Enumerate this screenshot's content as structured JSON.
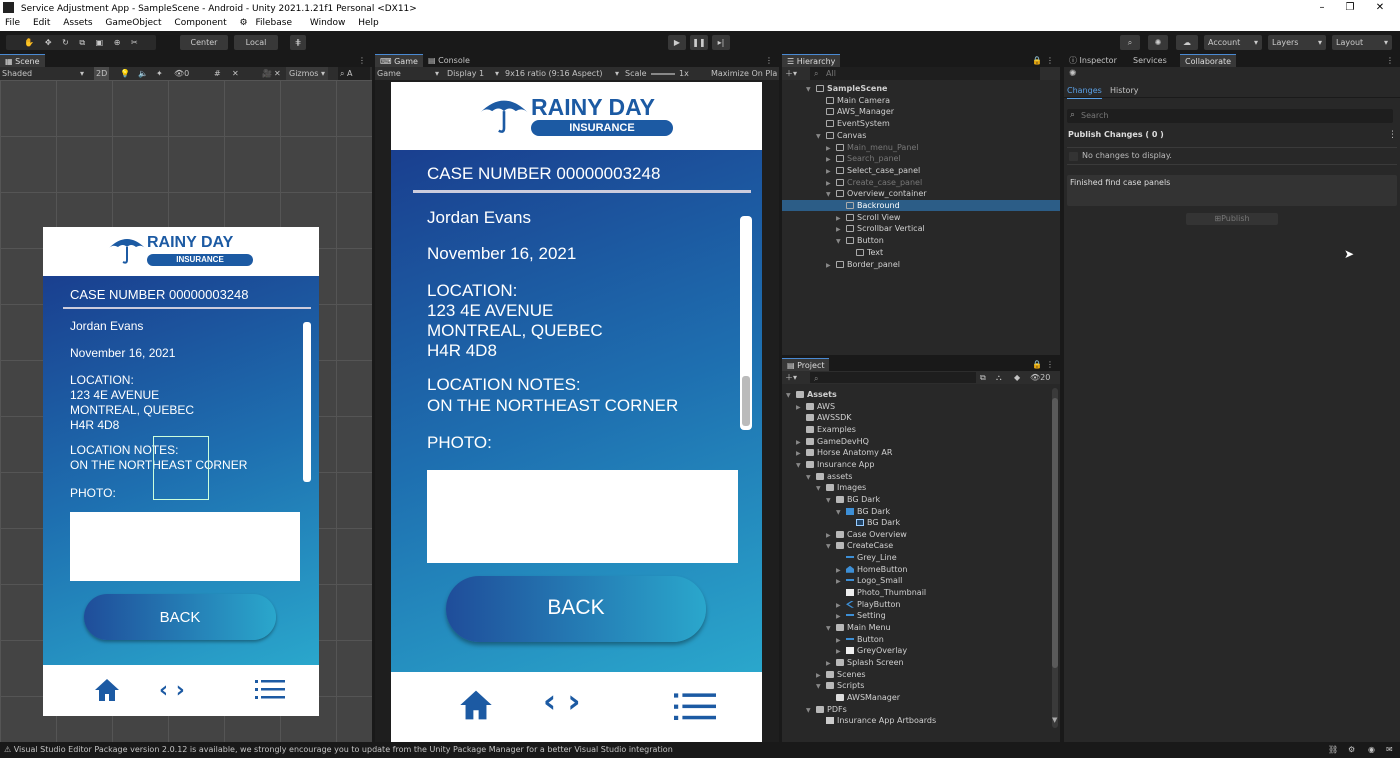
{
  "window": {
    "title": "Service Adjustment App - SampleScene - Android - Unity 2021.1.21f1 Personal <DX11>",
    "minimize": "–",
    "maximize": "❐",
    "close": "✕"
  },
  "menu": [
    "File",
    "Edit",
    "Assets",
    "GameObject",
    "Component",
    "Filebase",
    "Window",
    "Help"
  ],
  "toolbar": {
    "pivot": "Center",
    "space": "Local",
    "account": "Account",
    "layers": "Layers",
    "layout": "Layout"
  },
  "scene_panel": {
    "tab": "Scene",
    "shading": "Shaded",
    "mode": "2D",
    "gizmos": "Gizmos"
  },
  "game_panel": {
    "tabs": [
      "Game",
      "Console"
    ],
    "display_mode": "Game",
    "display": "Display 1",
    "aspect": "9x16 ratio (9:16 Aspect)",
    "scale_label": "Scale",
    "scale_value": "1x",
    "maximize": "Maximize On Pla"
  },
  "app": {
    "brand": "RAINY DAY",
    "brand_sub": "INSURANCE",
    "case_number": "CASE NUMBER 00000003248",
    "name": "Jordan Evans",
    "date": "November 16, 2021",
    "location_label": "LOCATION:",
    "location_lines": [
      "123 4E AVENUE",
      "MONTREAL, QUEBEC",
      "H4R 4D8"
    ],
    "notes_label": "LOCATION NOTES:",
    "notes": "ON THE NORTHEAST CORNER",
    "photo_label": "PHOTO:",
    "back": "BACK"
  },
  "hierarchy": {
    "tab": "Hierarchy",
    "search_placeholder": "All",
    "rows": [
      {
        "label": "SampleScene",
        "depth": 0,
        "state": "normal",
        "arrow": "▼"
      },
      {
        "label": "Main Camera",
        "depth": 1,
        "state": "normal",
        "arrow": ""
      },
      {
        "label": "AWS_Manager",
        "depth": 1,
        "state": "normal",
        "arrow": ""
      },
      {
        "label": "EventSystem",
        "depth": 1,
        "state": "normal",
        "arrow": ""
      },
      {
        "label": "Canvas",
        "depth": 1,
        "state": "normal",
        "arrow": "▼"
      },
      {
        "label": "Main_menu_Panel",
        "depth": 2,
        "state": "dim",
        "arrow": "▶"
      },
      {
        "label": "Search_panel",
        "depth": 2,
        "state": "dim",
        "arrow": "▶"
      },
      {
        "label": "Select_case_panel",
        "depth": 2,
        "state": "normal",
        "arrow": "▶"
      },
      {
        "label": "Create_case_panel",
        "depth": 2,
        "state": "dim",
        "arrow": "▶"
      },
      {
        "label": "Overview_container",
        "depth": 2,
        "state": "normal",
        "arrow": "▼"
      },
      {
        "label": "Backround",
        "depth": 3,
        "state": "sel",
        "arrow": ""
      },
      {
        "label": "Scroll View",
        "depth": 3,
        "state": "normal",
        "arrow": "▶"
      },
      {
        "label": "Scrollbar Vertical",
        "depth": 3,
        "state": "normal",
        "arrow": "▶"
      },
      {
        "label": "Button",
        "depth": 3,
        "state": "normal",
        "arrow": "▼"
      },
      {
        "label": "Text",
        "depth": 4,
        "state": "normal",
        "arrow": ""
      },
      {
        "label": "Border_panel",
        "depth": 2,
        "state": "normal",
        "arrow": "▶"
      }
    ]
  },
  "project": {
    "tab": "Project",
    "hidden_count": "20",
    "rows": [
      {
        "label": "Assets",
        "depth": 0,
        "arrow": "▼",
        "icon": "folder"
      },
      {
        "label": "AWS",
        "depth": 1,
        "arrow": "▶",
        "icon": "folder"
      },
      {
        "label": "AWSSDK",
        "depth": 1,
        "arrow": "",
        "icon": "folder"
      },
      {
        "label": "Examples",
        "depth": 1,
        "arrow": "",
        "icon": "folder"
      },
      {
        "label": "GameDevHQ",
        "depth": 1,
        "arrow": "▶",
        "icon": "folder"
      },
      {
        "label": "Horse Anatomy AR",
        "depth": 1,
        "arrow": "▶",
        "icon": "folder"
      },
      {
        "label": "Insurance App",
        "depth": 1,
        "arrow": "▼",
        "icon": "folder"
      },
      {
        "label": "assets",
        "depth": 2,
        "arrow": "▼",
        "icon": "folder"
      },
      {
        "label": "Images",
        "depth": 3,
        "arrow": "▼",
        "icon": "folder"
      },
      {
        "label": "BG Dark",
        "depth": 4,
        "arrow": "▼",
        "icon": "folder"
      },
      {
        "label": "BG Dark",
        "depth": 5,
        "arrow": "▼",
        "icon": "image"
      },
      {
        "label": "BG Dark",
        "depth": 6,
        "arrow": "",
        "icon": "sprite"
      },
      {
        "label": "Case Overview",
        "depth": 4,
        "arrow": "▶",
        "icon": "folder"
      },
      {
        "label": "CreateCase",
        "depth": 4,
        "arrow": "▼",
        "icon": "folder"
      },
      {
        "label": "Grey_Line",
        "depth": 5,
        "arrow": "",
        "icon": "line"
      },
      {
        "label": "HomeButton",
        "depth": 5,
        "arrow": "▶",
        "icon": "home"
      },
      {
        "label": "Logo_Small",
        "depth": 5,
        "arrow": "▶",
        "icon": "line"
      },
      {
        "label": "Photo_Thumbnail",
        "depth": 5,
        "arrow": "",
        "icon": "white"
      },
      {
        "label": "PlayButton",
        "depth": 5,
        "arrow": "▶",
        "icon": "chev"
      },
      {
        "label": "Setting",
        "depth": 5,
        "arrow": "▶",
        "icon": "line"
      },
      {
        "label": "Main Menu",
        "depth": 4,
        "arrow": "▼",
        "icon": "folder"
      },
      {
        "label": "Button",
        "depth": 5,
        "arrow": "▶",
        "icon": "line"
      },
      {
        "label": "GreyOverlay",
        "depth": 5,
        "arrow": "▶",
        "icon": "white"
      },
      {
        "label": "Splash Screen",
        "depth": 4,
        "arrow": "▶",
        "icon": "folder"
      },
      {
        "label": "Scenes",
        "depth": 3,
        "arrow": "▶",
        "icon": "folder"
      },
      {
        "label": "Scripts",
        "depth": 3,
        "arrow": "▼",
        "icon": "folder"
      },
      {
        "label": "AWSManager",
        "depth": 4,
        "arrow": "",
        "icon": "script"
      },
      {
        "label": "PDFs",
        "depth": 2,
        "arrow": "▼",
        "icon": "folder"
      },
      {
        "label": "Insurance App Artboards",
        "depth": 3,
        "arrow": "",
        "icon": "doc"
      }
    ]
  },
  "inspector": {
    "tabs": [
      "Inspector",
      "Services",
      "Collaborate"
    ],
    "sub_tabs": [
      "Changes",
      "History"
    ],
    "search_placeholder": "Search",
    "publish_header": "Publish Changes ( 0 )",
    "no_changes": "No changes to display.",
    "commit_message": "Finished find case panels",
    "publish_button": "Publish"
  },
  "status": {
    "message": "Visual Studio Editor Package version 2.0.12 is available, we strongly encourage you to update from the Unity Package Manager for a better Visual Studio integration"
  },
  "colors": {
    "brand_blue": "#1c5aa3",
    "mobile_gradient_top": "#1a3f8f",
    "mobile_gradient_bottom": "#2a9bc4",
    "selection": "#2c5d87"
  }
}
